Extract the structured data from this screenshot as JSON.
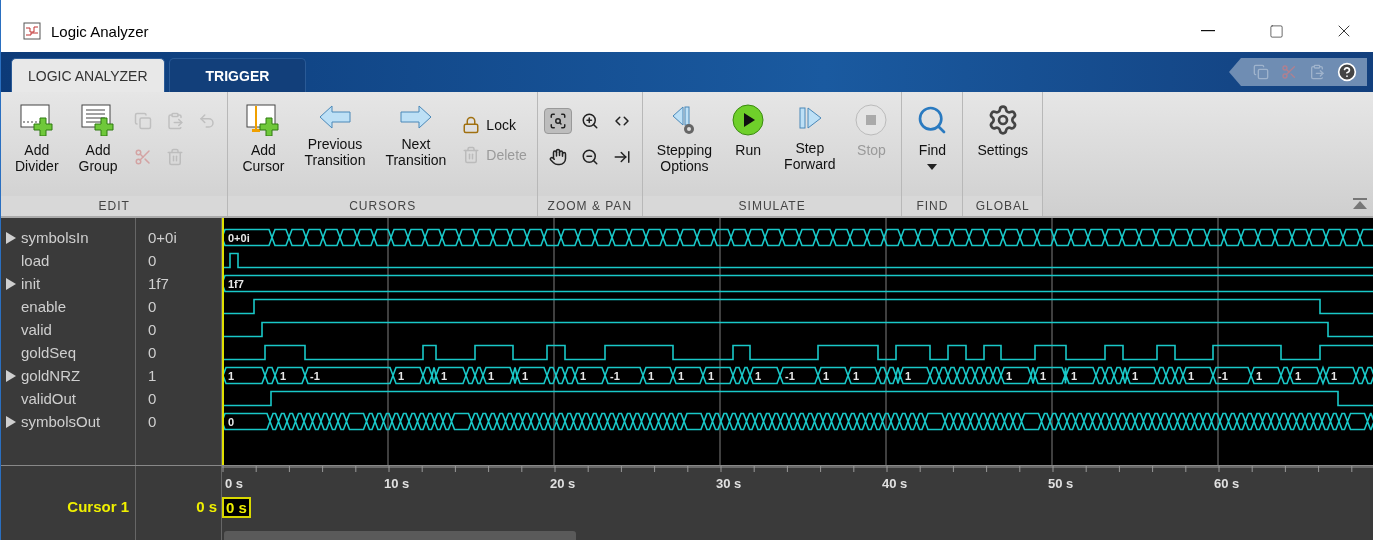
{
  "window": {
    "title": "Logic Analyzer"
  },
  "tabs": [
    {
      "label": "LOGIC ANALYZER",
      "selected": true
    },
    {
      "label": "TRIGGER",
      "selected": false
    }
  ],
  "toolbar": {
    "groups": [
      {
        "label": "EDIT",
        "buttons": [
          {
            "label": "Add Divider",
            "disabled": false
          },
          {
            "label": "Add Group",
            "disabled": false
          }
        ],
        "small_buttons": [
          {
            "disabled": true
          },
          {
            "disabled": true
          },
          {
            "disabled": true
          },
          {
            "disabled": true
          },
          {
            "disabled": true
          }
        ]
      },
      {
        "label": "CURSORS",
        "buttons": [
          {
            "label": "Add Cursor",
            "disabled": false
          },
          {
            "label": "Previous Transition",
            "disabled": false
          },
          {
            "label": "Next Transition",
            "disabled": false
          }
        ],
        "side_buttons": [
          {
            "label": "Lock",
            "disabled": false
          },
          {
            "label": "Delete",
            "disabled": true
          }
        ]
      },
      {
        "label": "ZOOM & PAN",
        "small_buttons": [
          {
            "selected": true
          },
          {
            "selected": false
          },
          {
            "selected": false
          },
          {
            "selected": false
          },
          {
            "selected": false
          },
          {
            "selected": false
          }
        ]
      },
      {
        "label": "SIMULATE",
        "buttons": [
          {
            "label": "Stepping Options",
            "disabled": false
          },
          {
            "label": "Run",
            "disabled": false
          },
          {
            "label": "Step Forward",
            "disabled": false
          },
          {
            "label": "Stop",
            "disabled": true
          }
        ]
      },
      {
        "label": "FIND",
        "buttons": [
          {
            "label": "Find",
            "disabled": false
          }
        ]
      },
      {
        "label": "GLOBAL",
        "buttons": [
          {
            "label": "Settings",
            "disabled": false
          }
        ]
      }
    ]
  },
  "signals": [
    {
      "name": "symbolsIn",
      "value": "0+0i",
      "kind": "bus",
      "expanded": false,
      "labels": [
        "0+0i"
      ]
    },
    {
      "name": "load",
      "value": "0",
      "kind": "bit"
    },
    {
      "name": "init",
      "value": "1f7",
      "kind": "bus",
      "expanded": false,
      "labels": [
        "1f7"
      ]
    },
    {
      "name": "enable",
      "value": "0",
      "kind": "bit"
    },
    {
      "name": "valid",
      "value": "0",
      "kind": "bit"
    },
    {
      "name": "goldSeq",
      "value": "0",
      "kind": "bit"
    },
    {
      "name": "goldNRZ",
      "value": "1",
      "kind": "bus",
      "expanded": false,
      "labels": [
        "1",
        "1",
        "-1",
        "1",
        "1",
        "1",
        "1",
        "1",
        "-1",
        "1",
        "1",
        "1",
        "1",
        "-1",
        "1",
        "1",
        "1",
        "1",
        "1",
        "1",
        "1",
        "1",
        "-1",
        "1",
        "1",
        "1"
      ]
    },
    {
      "name": "validOut",
      "value": "0",
      "kind": "bit"
    },
    {
      "name": "symbolsOut",
      "value": "0",
      "kind": "bus",
      "expanded": false,
      "labels": [
        "0"
      ]
    }
  ],
  "axis": {
    "ticks": [
      "0 s",
      "10 s",
      "20 s",
      "30 s",
      "40 s",
      "50 s",
      "60 s"
    ]
  },
  "cursor": {
    "name": "Cursor 1",
    "value": "0 s",
    "marker": "0 s"
  }
}
